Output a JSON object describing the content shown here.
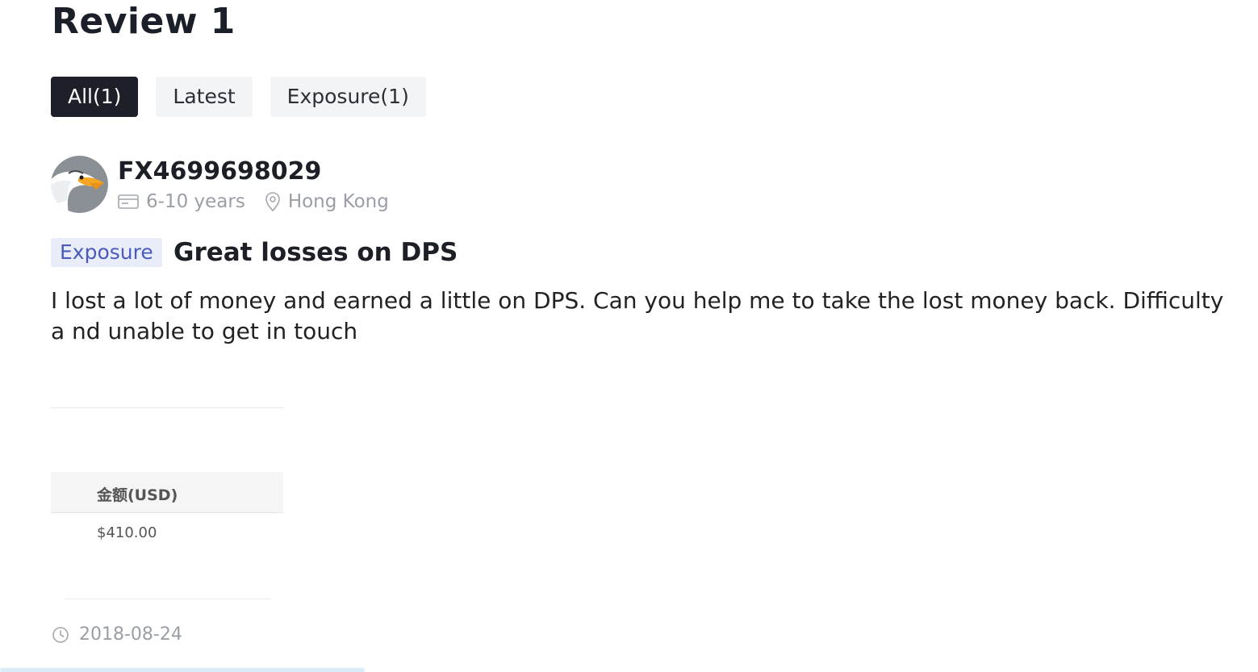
{
  "page": {
    "title": "Review 1"
  },
  "tabs": [
    {
      "label": "All(1)",
      "active": true
    },
    {
      "label": "Latest",
      "active": false
    },
    {
      "label": "Exposure(1)",
      "active": false
    }
  ],
  "review": {
    "user": {
      "name": "FX4699698029",
      "avatar": "eagle-avatar",
      "experience": "6-10 years",
      "location": "Hong Kong"
    },
    "badge": "Exposure",
    "title": "Great losses on DPS",
    "body": "I lost a lot of money and earned a little on DPS. Can you help me to take the lost money back. Difficulty a nd unable to get in touch",
    "attachment": {
      "column_header": "金额(USD)",
      "value": "$410.00"
    },
    "date": "2018-08-24"
  },
  "icons": {
    "experience": "id-card-icon",
    "location": "location-pin-icon",
    "date": "clock-icon"
  },
  "colors": {
    "active_tab_bg": "#1d2029",
    "tab_bg": "#f3f4f6",
    "badge_bg": "#e9ecf9",
    "badge_text": "#4a5bbd",
    "muted_text": "#9a9ea6"
  }
}
